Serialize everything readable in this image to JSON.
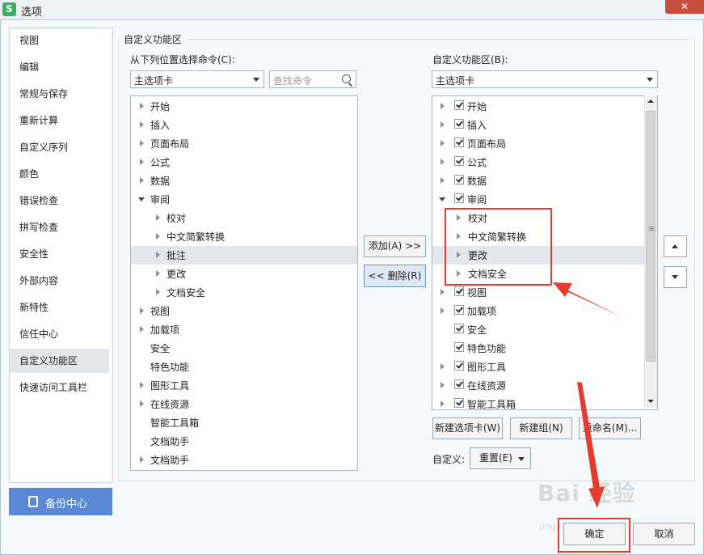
{
  "window": {
    "app_icon": "S",
    "title": "选项",
    "close_label": "✕"
  },
  "nav": {
    "items": [
      "视图",
      "编辑",
      "常规与保存",
      "重新计算",
      "自定义序列",
      "颜色",
      "错误检查",
      "拼写检查",
      "安全性",
      "外部内容",
      "新特性",
      "信任中心",
      "自定义功能区",
      "快速访问工具栏"
    ],
    "selected": "自定义功能区"
  },
  "backup": {
    "label": "备份中心"
  },
  "group_title": "自定义功能区",
  "left_panel": {
    "label": "从下列位置选择命令(C):",
    "combo_value": "主选项卡",
    "search_placeholder": "查找命令",
    "items": [
      {
        "text": "开始"
      },
      {
        "text": "插入"
      },
      {
        "text": "页面布局"
      },
      {
        "text": "公式"
      },
      {
        "text": "数据"
      },
      {
        "text": "审阅"
      },
      {
        "text": "校对"
      },
      {
        "text": "中文简繁转换"
      },
      {
        "text": "批注"
      },
      {
        "text": "更改"
      },
      {
        "text": "文档安全"
      },
      {
        "text": "视图"
      },
      {
        "text": "加载项"
      },
      {
        "text": "安全"
      },
      {
        "text": "特色功能"
      },
      {
        "text": "图形工具"
      },
      {
        "text": "在线资源"
      },
      {
        "text": "智能工具箱"
      },
      {
        "text": "文档助手"
      },
      {
        "text": "文档助手"
      }
    ]
  },
  "middle": {
    "add_label": "添加(A) >>",
    "remove_label": "<< 删除(R)"
  },
  "right_panel": {
    "label": "自定义功能区(B):",
    "combo_value": "主选项卡",
    "items": [
      {
        "text": "开始"
      },
      {
        "text": "插入"
      },
      {
        "text": "页面布局"
      },
      {
        "text": "公式"
      },
      {
        "text": "数据"
      },
      {
        "text": "审阅"
      },
      {
        "text": "校对"
      },
      {
        "text": "中文简繁转换"
      },
      {
        "text": "更改"
      },
      {
        "text": "文档安全"
      },
      {
        "text": "视图"
      },
      {
        "text": "加载项"
      },
      {
        "text": "安全"
      },
      {
        "text": "特色功能"
      },
      {
        "text": "图形工具"
      },
      {
        "text": "在线资源"
      },
      {
        "text": "智能工具箱"
      }
    ],
    "new_tab_label": "新建选项卡(W)",
    "new_group_label": "新建组(N)",
    "rename_label": "重命名(M)...",
    "customize_label": "自定义:",
    "reset_label": "重置(E)"
  },
  "footer": {
    "ok_label": "确定",
    "cancel_label": "取消"
  },
  "watermark": {
    "main": "Bai 经验",
    "sub": "jingyan.baidu.com"
  },
  "colors": {
    "accent": "#5b88d6",
    "highlight_red": "#e23c2f",
    "close_red": "#c84f3b"
  }
}
